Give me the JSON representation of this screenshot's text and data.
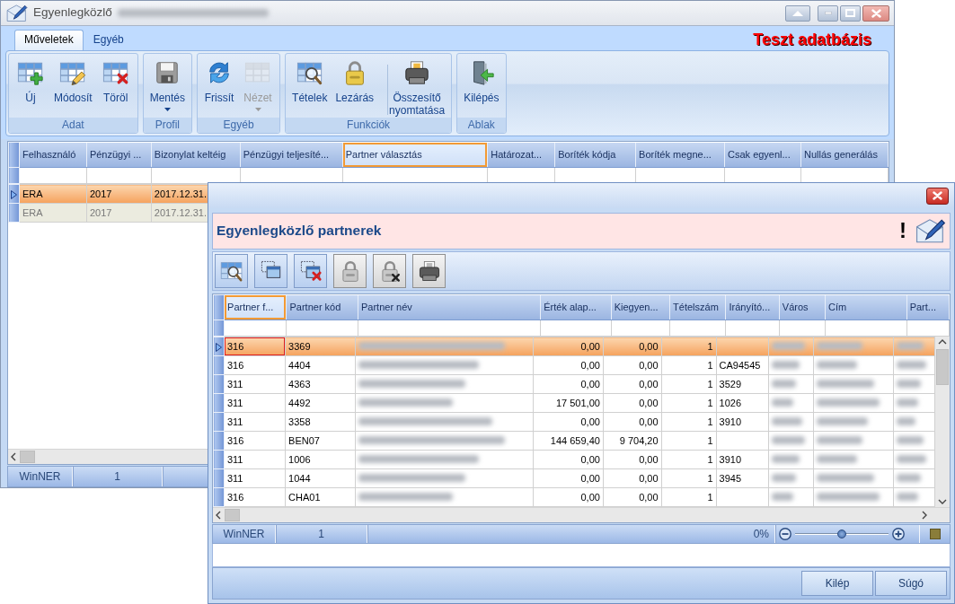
{
  "main_window": {
    "title": "Egyenlegközlő",
    "ribbon": {
      "tabs": [
        {
          "label": "Műveletek",
          "selected": true
        },
        {
          "label": "Egyéb",
          "selected": false
        }
      ],
      "notice": "Teszt adatbázis",
      "groups": [
        {
          "label": "Adat",
          "buttons": [
            {
              "label": "Új",
              "disabled": false,
              "dropdown": false
            },
            {
              "label": "Módosít",
              "disabled": false,
              "dropdown": false
            },
            {
              "label": "Töröl",
              "disabled": false,
              "dropdown": false
            }
          ]
        },
        {
          "label": "Profil",
          "buttons": [
            {
              "label": "Mentés",
              "disabled": false,
              "dropdown": true
            }
          ]
        },
        {
          "label": "Egyéb",
          "buttons": [
            {
              "label": "Frissít",
              "disabled": false,
              "dropdown": false
            },
            {
              "label": "Nézet",
              "disabled": true,
              "dropdown": true
            }
          ]
        },
        {
          "label": "Funkciók",
          "buttons": [
            {
              "label": "Tételek",
              "disabled": false,
              "dropdown": false
            },
            {
              "label": "Lezárás",
              "disabled": false,
              "dropdown": false
            },
            {
              "label": "Összesítő nyomtatása",
              "disabled": false,
              "dropdown": false,
              "separator": true
            }
          ]
        },
        {
          "label": "Ablak",
          "buttons": [
            {
              "label": "Kilépés",
              "disabled": false,
              "dropdown": false
            }
          ]
        }
      ]
    },
    "grid": {
      "columns": [
        {
          "label": "Felhasználó",
          "focused": false
        },
        {
          "label": "Pénzügyi ...",
          "focused": false
        },
        {
          "label": "Bizonylat keltéig",
          "focused": false
        },
        {
          "label": "Pénzügyi teljesíté...",
          "focused": false
        },
        {
          "label": "Partner választás",
          "focused": true
        },
        {
          "label": "Határozat...",
          "focused": false
        },
        {
          "label": "Boríték kódja",
          "focused": false
        },
        {
          "label": "Boríték megne...",
          "focused": false
        },
        {
          "label": "Csak egyenl...",
          "focused": false
        },
        {
          "label": "Nullás generálás",
          "focused": false
        }
      ],
      "rows": [
        {
          "selected": true,
          "disabled": false,
          "cells": [
            "ERA",
            "2017",
            "2017.12.31."
          ]
        },
        {
          "selected": false,
          "disabled": true,
          "cells": [
            "ERA",
            "2017",
            "2017.12.31."
          ]
        }
      ]
    },
    "status_bar": {
      "cells": [
        "WinNER",
        "1"
      ]
    }
  },
  "dialog": {
    "header": {
      "title": "Egyenlegközlő partnerek",
      "alert": "!"
    },
    "toolbar": [
      {
        "disabled": false
      },
      {
        "disabled": false
      },
      {
        "disabled": false
      },
      {
        "disabled": true
      },
      {
        "disabled": true
      },
      {
        "disabled": true
      }
    ],
    "grid": {
      "columns": [
        {
          "label": "Partner f...",
          "kind": "text",
          "focused": true
        },
        {
          "label": "Partner kód",
          "kind": "text",
          "focused": false
        },
        {
          "label": "Partner név",
          "kind": "redacted",
          "focused": false
        },
        {
          "label": "Érték alap...",
          "kind": "number",
          "focused": false
        },
        {
          "label": "Kiegyen...",
          "kind": "number",
          "focused": false
        },
        {
          "label": "Tételszám",
          "kind": "number",
          "focused": false
        },
        {
          "label": "Irányító...",
          "kind": "text",
          "focused": false
        },
        {
          "label": "Város",
          "kind": "redacted",
          "focused": false
        },
        {
          "label": "Cím",
          "kind": "redacted",
          "focused": false
        },
        {
          "label": "Part...",
          "kind": "redacted",
          "focused": false
        }
      ],
      "rows": [
        {
          "selected": true,
          "cells": [
            "316",
            "3369",
            null,
            "0,00",
            "0,00",
            "1"
          ]
        },
        {
          "selected": false,
          "cells": [
            "316",
            "4404",
            null,
            "0,00",
            "0,00",
            "1",
            "CA94545"
          ]
        },
        {
          "selected": false,
          "cells": [
            "311",
            "4363",
            null,
            "0,00",
            "0,00",
            "1",
            "3529"
          ]
        },
        {
          "selected": false,
          "cells": [
            "311",
            "4492",
            null,
            "17 501,00",
            "0,00",
            "1",
            "1026"
          ]
        },
        {
          "selected": false,
          "cells": [
            "311",
            "3358",
            null,
            "0,00",
            "0,00",
            "1",
            "3910"
          ]
        },
        {
          "selected": false,
          "cells": [
            "316",
            "BEN07",
            null,
            "144 659,40",
            "9 704,20",
            "1"
          ]
        },
        {
          "selected": false,
          "cells": [
            "311",
            "1006",
            null,
            "0,00",
            "0,00",
            "1",
            "3910"
          ]
        },
        {
          "selected": false,
          "cells": [
            "311",
            "1044",
            null,
            "0,00",
            "0,00",
            "1",
            "3945"
          ]
        },
        {
          "selected": false,
          "cells": [
            "316",
            "CHA01",
            null,
            "0,00",
            "0,00",
            "1"
          ]
        }
      ]
    },
    "status_bar": {
      "cells": [
        "WinNER",
        "1"
      ],
      "zoom_reading": "0%",
      "zoom": {
        "level": 0.5
      }
    },
    "buttons": [
      "Kilép",
      "Súgó"
    ]
  }
}
